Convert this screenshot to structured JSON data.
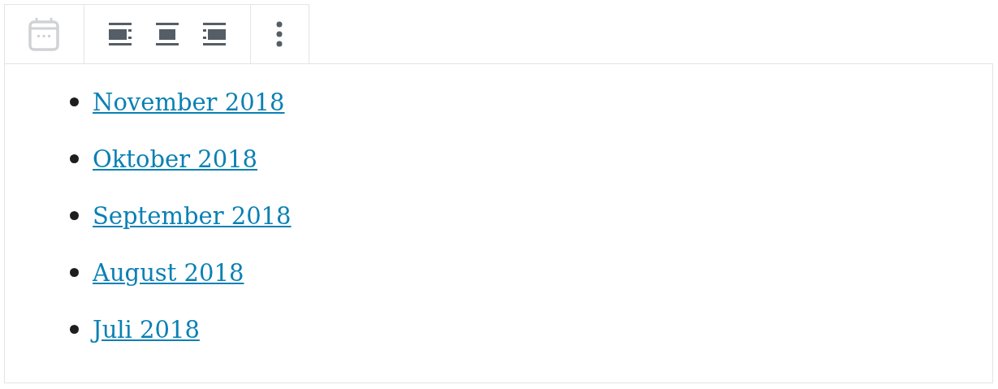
{
  "archive_links": [
    {
      "label": "November 2018"
    },
    {
      "label": "Oktober 2018"
    },
    {
      "label": "September 2018"
    },
    {
      "label": "August 2018"
    },
    {
      "label": "Juli 2018"
    }
  ]
}
